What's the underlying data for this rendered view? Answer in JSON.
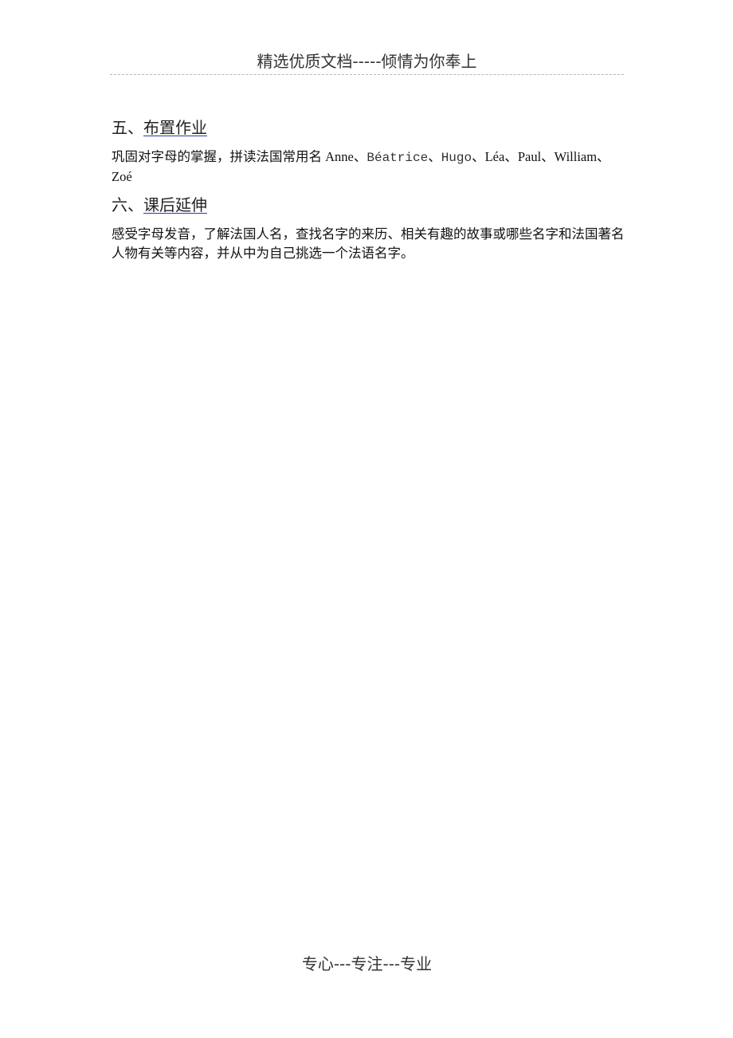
{
  "header": {
    "text": "精选优质文档-----倾情为你奉上"
  },
  "sections": [
    {
      "number": "五、",
      "title": "布置作业",
      "body_prefix": "巩固对字母的掌握，拼读法国常用名 Anne、",
      "body_name_2": "Béatrice",
      "body_sep_2": "、",
      "body_name_3": "Hugo",
      "body_suffix": "、Léa、Paul、William、Zoé"
    },
    {
      "number": "六、",
      "title": "课后延伸",
      "body": "感受字母发音，了解法国人名，查找名字的来历、相关有趣的故事或哪些名字和法国著名人物有关等内容，并从中为自己挑选一个法语名字。"
    }
  ],
  "footer": {
    "text": "专心---专注---专业"
  }
}
